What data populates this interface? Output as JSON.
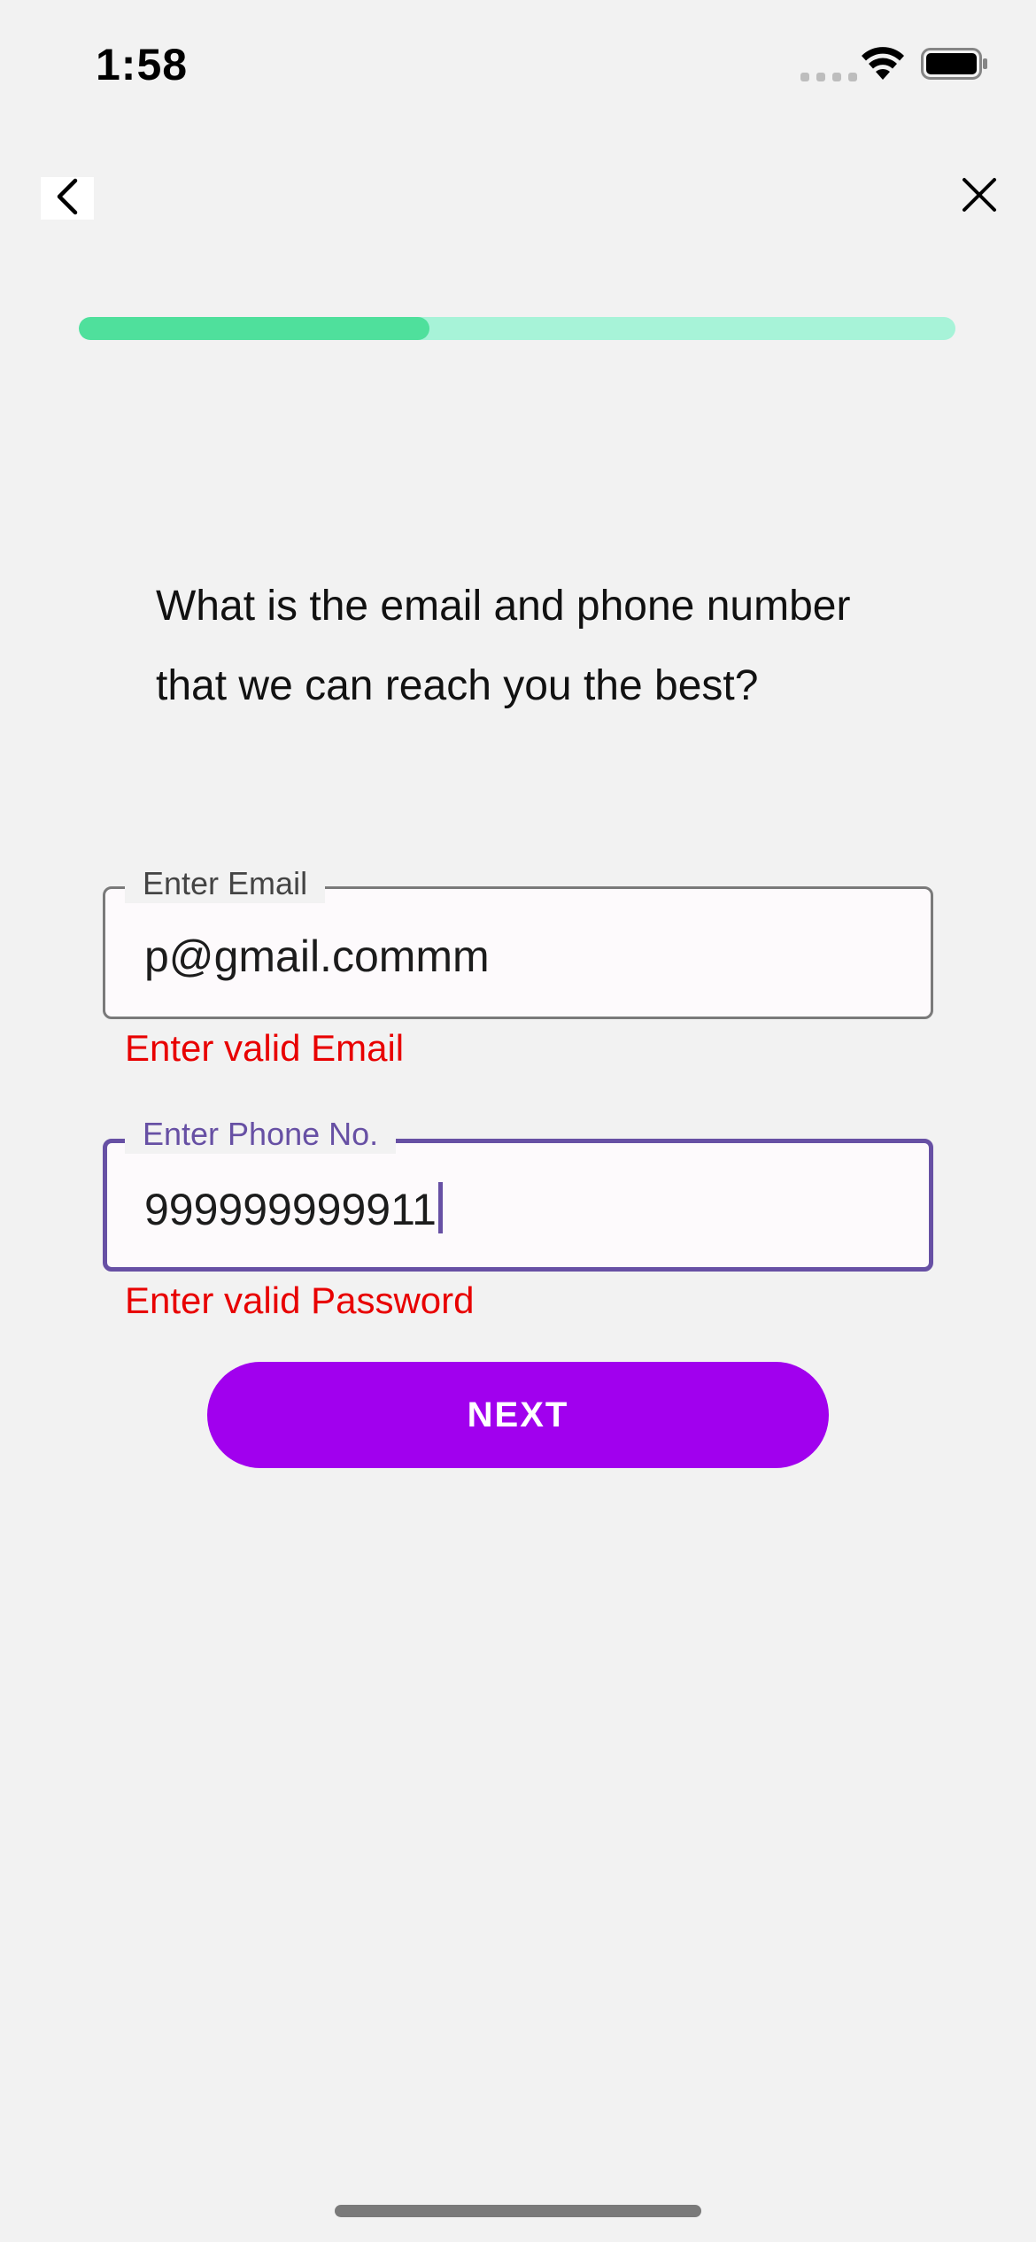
{
  "status_bar": {
    "time": "1:58",
    "icons": [
      "cellular-signal-icon",
      "wifi-icon",
      "battery-icon"
    ]
  },
  "nav": {
    "back_icon": "chevron-left-icon",
    "close_icon": "close-icon"
  },
  "progress": {
    "fraction": 0.4,
    "fill_color": "#4fe09c",
    "track_color": "#a7f3d8"
  },
  "question": {
    "line1": "What is the email and phone number",
    "line2": "that we can reach you the best?"
  },
  "email_field": {
    "label": "Enter Email",
    "value": "p@gmail.commm",
    "error": "Enter valid Email"
  },
  "phone_field": {
    "label": "Enter Phone No.",
    "value": "999999999911",
    "error": "Enter valid Password",
    "focused": true
  },
  "next_button": {
    "label": "NEXT",
    "color": "#a100ee"
  },
  "colors": {
    "background": "#f2f2f2",
    "focus": "#6750a4",
    "error": "#e80000"
  }
}
